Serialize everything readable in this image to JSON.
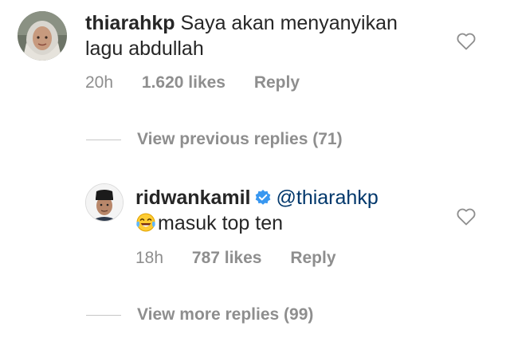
{
  "comment_1": {
    "username": "thiarahkp",
    "text_line1": "Saya akan menyanyikan",
    "text_line2": "lagu abdullah",
    "time": "20h",
    "likes": "1.620 likes",
    "reply": "Reply",
    "avatar_icon": "user-avatar-hijab"
  },
  "view_previous": {
    "label": "View previous replies (71)"
  },
  "comment_2": {
    "username": "ridwankamil",
    "verified_icon": "verified-badge-icon",
    "mention": "@thiarahkp",
    "emoji_icon": "face-with-tears-of-joy-emoji",
    "text": "masuk top ten",
    "time": "18h",
    "likes": "787 likes",
    "reply": "Reply",
    "avatar_icon": "user-avatar-peci"
  },
  "view_more": {
    "label": "View more replies (99)"
  },
  "colors": {
    "text": "#262626",
    "meta": "#8e8e8e",
    "mention": "#00376b",
    "verified": "#3897f0",
    "divider": "#c7c7c7"
  }
}
